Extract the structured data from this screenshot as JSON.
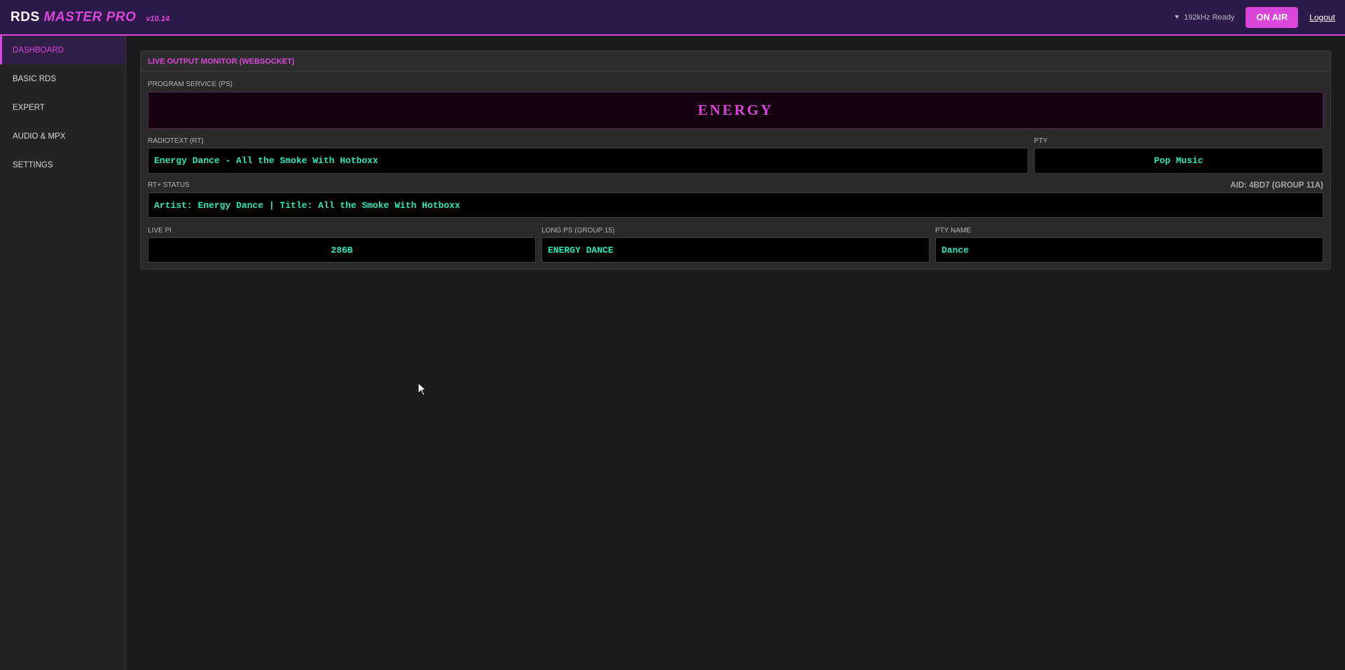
{
  "header": {
    "brand_rds": "RDS",
    "brand_master": "MASTER PRO",
    "version": "v10.14",
    "status_icon": "heart-icon",
    "status_text": "192kHz Ready",
    "onair_label": "ON AIR",
    "logout_label": "Logout"
  },
  "sidebar": {
    "items": [
      {
        "label": "DASHBOARD",
        "active": true
      },
      {
        "label": "BASIC RDS",
        "active": false
      },
      {
        "label": "EXPERT",
        "active": false
      },
      {
        "label": "AUDIO & MPX",
        "active": false
      },
      {
        "label": "SETTINGS",
        "active": false
      }
    ]
  },
  "monitor": {
    "title": "LIVE OUTPUT MONITOR (WEBSOCKET)",
    "ps_label": "PROGRAM SERVICE (PS)",
    "ps_value": "ENERGY",
    "rt_label": "RADIOTEXT (RT)",
    "rt_value": "Energy Dance - All the Smoke With Hotboxx",
    "pty_label": "PTY",
    "pty_value": "Pop Music",
    "rtplus_label": "RT+ STATUS",
    "aid_text": "AID: 4BD7 (GROUP 11A)",
    "rtplus_value": "Artist: Energy Dance | Title: All the Smoke With Hotboxx",
    "pi_label": "LIVE PI",
    "pi_value": "286B",
    "lps_label": "LONG PS (GROUP 15)",
    "lps_value": "ENERGY DANCE",
    "ptyn_label": "PTY NAME",
    "ptyn_value": "Dance"
  },
  "colors": {
    "accent": "#d946d9",
    "header_bg": "#2d1a4a",
    "value_text": "#2ee6b8",
    "background": "#1c1c1c"
  }
}
